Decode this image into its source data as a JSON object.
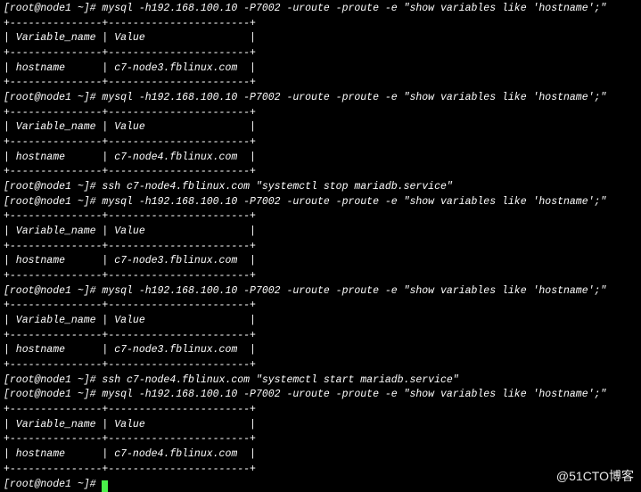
{
  "prompt": "[root@node1 ~]# ",
  "mysql_cmd": "mysql -h192.168.100.10 -P7002 -uroute -proute -e \"show variables like 'hostname';\"",
  "ssh_stop_cmd": "ssh c7-node4.fblinux.com \"systemctl stop mariadb.service\"",
  "ssh_start_cmd": "ssh c7-node4.fblinux.com \"systemctl start mariadb.service\"",
  "tbl_border": "+---------------+-----------------------+",
  "tbl_header": "| Variable_name | Value                 |",
  "row_node3": "| hostname      | c7-node3.fblinux.com  |",
  "row_node4": "| hostname      | c7-node4.fblinux.com  |",
  "watermark": "@51CTO博客"
}
